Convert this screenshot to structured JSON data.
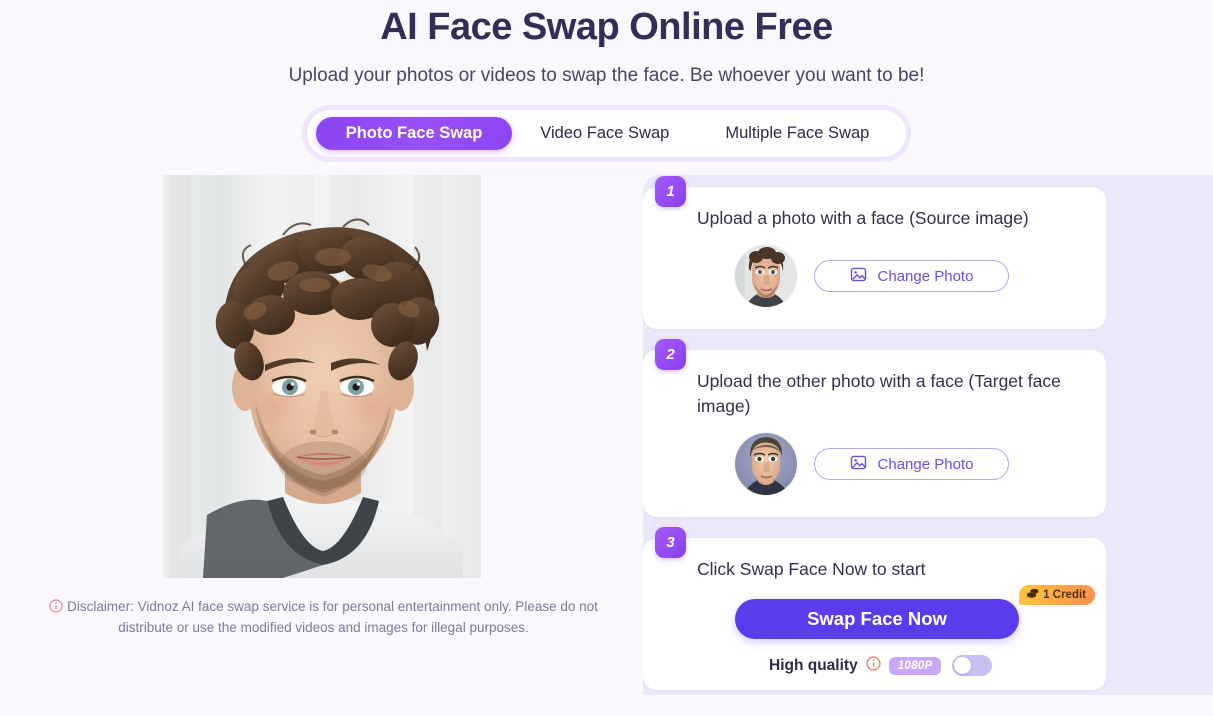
{
  "header": {
    "title": "AI Face Swap Online Free",
    "subtitle": "Upload your photos or videos to swap the face. Be whoever you want to be!"
  },
  "tabs": [
    {
      "label": "Photo Face Swap",
      "active": true
    },
    {
      "label": "Video Face Swap",
      "active": false
    },
    {
      "label": "Multiple Face Swap",
      "active": false
    }
  ],
  "preview": {
    "alt": "portrait-of-man-with-curly-brown-hair"
  },
  "disclaimer": {
    "icon": "info-circle-icon",
    "text": "Disclaimer: Vidnoz AI face swap service is for personal entertainment only. Please do not distribute or use the modified videos and images for illegal purposes."
  },
  "steps": [
    {
      "number": "1",
      "title": "Upload a photo with a face (Source image)",
      "thumb_alt": "source-face-thumbnail",
      "button_label": "Change Photo",
      "button_icon": "image-icon"
    },
    {
      "number": "2",
      "title": "Upload the other photo with a face (Target face image)",
      "thumb_alt": "target-face-thumbnail",
      "button_label": "Change Photo",
      "button_icon": "image-icon"
    },
    {
      "number": "3",
      "title": "Click Swap Face Now to start",
      "swap_button_label": "Swap Face Now",
      "credit_badge": "1 Credit",
      "credit_icon": "coins-icon",
      "quality_label": "High quality",
      "quality_info_icon": "info-circle-icon",
      "resolution_badge": "1080P",
      "toggle_state": "off"
    }
  ],
  "colors": {
    "page_background": "#faf7fd",
    "panel_background": "#ebe8fa",
    "title": "#342d58",
    "accent_purple": "#8d43f2",
    "swap_button": "#5a3ced",
    "credit_badge_start": "#ffc53d",
    "credit_badge_end": "#ff9052",
    "info_icon": "#e8846c",
    "resolution_badge": "#c9a9f7"
  }
}
